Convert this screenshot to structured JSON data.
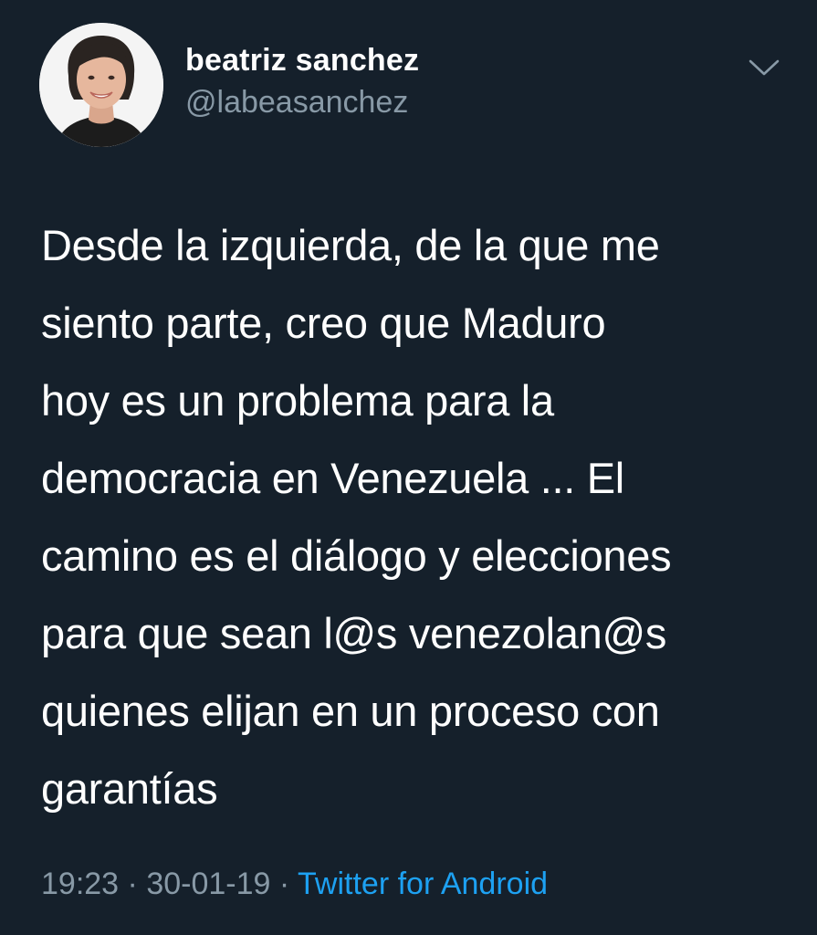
{
  "tweet": {
    "author": {
      "display_name": "beatriz sanchez",
      "handle": "@labeasanchez",
      "avatar_icon": "profile-photo"
    },
    "menu_icon": "chevron-down-icon",
    "text": "Desde la izquierda, de la que me\nsiento parte,  creo que Maduro\nhoy es un problema para la\ndemocracia en Venezuela ... El\ncamino es el diálogo y elecciones\npara que sean l@s venezolan@s\nquienes elijan en un proceso con\ngarantías",
    "time": "19:23",
    "separator": " · ",
    "date": "30-01-19",
    "source": "Twitter for Android"
  },
  "colors": {
    "background": "#15202b",
    "text": "#ffffff",
    "secondary": "#8899a6",
    "link": "#1da1f2"
  }
}
